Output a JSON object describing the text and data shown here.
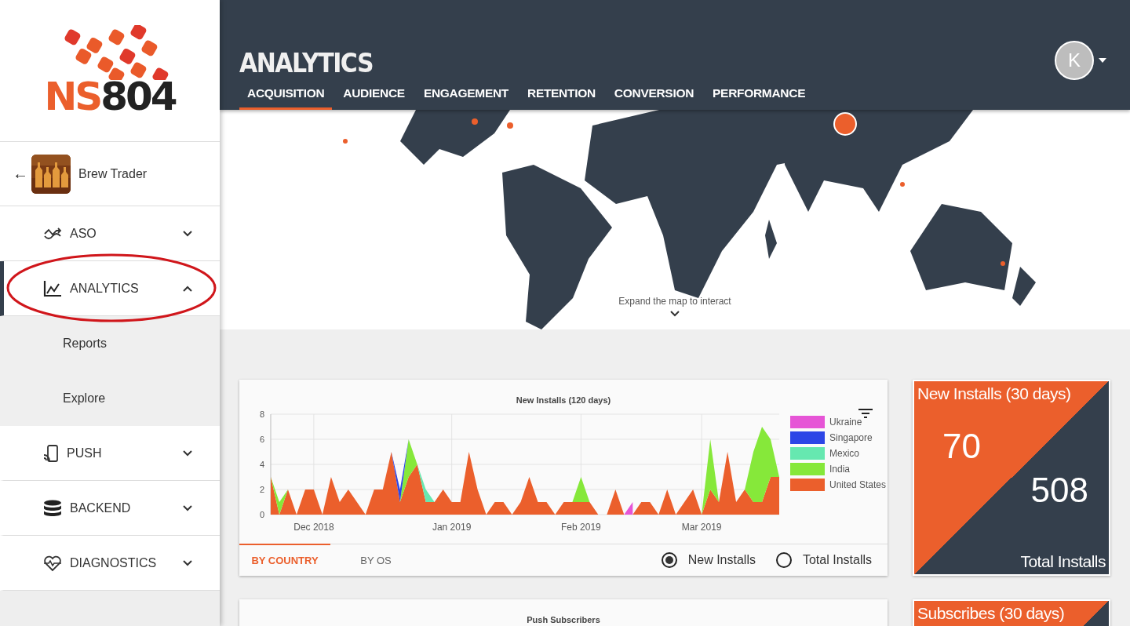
{
  "logo": {
    "accent": "NS",
    "rest": "804"
  },
  "app": {
    "back": "←",
    "name": "Brew Trader"
  },
  "nav": [
    {
      "label": "ASO",
      "expanded": false,
      "selected": false
    },
    {
      "label": "ANALYTICS",
      "expanded": true,
      "selected": true,
      "children": [
        {
          "label": "Reports"
        },
        {
          "label": "Explore"
        }
      ]
    },
    {
      "label": "PUSH",
      "expanded": false,
      "selected": false
    },
    {
      "label": "BACKEND",
      "expanded": false,
      "selected": false
    },
    {
      "label": "DIAGNOSTICS",
      "expanded": false,
      "selected": false
    }
  ],
  "header": {
    "title": "ANALYTICS",
    "avatar": "K",
    "tabs": [
      {
        "label": "ACQUISITION",
        "selected": true
      },
      {
        "label": "AUDIENCE",
        "selected": false
      },
      {
        "label": "ENGAGEMENT",
        "selected": false
      },
      {
        "label": "RETENTION",
        "selected": false
      },
      {
        "label": "CONVERSION",
        "selected": false
      },
      {
        "label": "PERFORMANCE",
        "selected": false
      }
    ]
  },
  "map": {
    "kind": "picture",
    "hint": "Expand the map to interact"
  },
  "installs_chart": {
    "chart_data": {
      "type": "area",
      "title": "New Installs (120 days)",
      "stacked": true,
      "categories": [
        null,
        null,
        null,
        null,
        null,
        "Dec 2018",
        null,
        null,
        null,
        null,
        null,
        null,
        null,
        null,
        null,
        null,
        null,
        null,
        null,
        null,
        null,
        "Jan 2019",
        null,
        null,
        null,
        null,
        null,
        null,
        null,
        null,
        null,
        null,
        null,
        null,
        null,
        null,
        "Feb 2019",
        null,
        null,
        null,
        null,
        null,
        null,
        null,
        null,
        null,
        null,
        null,
        null,
        null,
        "Mar 2019",
        null,
        null,
        null,
        null,
        null,
        null,
        null,
        null,
        null
      ],
      "ylim": [
        0,
        8
      ],
      "grid": true,
      "yticks": [
        0,
        2,
        4,
        6,
        8
      ],
      "series": [
        {
          "name": "United States",
          "color": "#eb5f2c",
          "values": [
            3,
            0,
            2,
            0,
            2,
            2,
            0,
            3,
            1,
            2,
            1,
            0,
            2,
            2,
            5,
            1,
            3,
            4,
            1,
            1,
            2,
            1,
            1,
            5,
            2,
            0,
            1,
            1,
            0,
            1,
            3,
            1,
            1,
            0,
            1,
            1,
            1,
            1,
            0,
            0,
            2,
            0,
            0,
            1,
            1,
            0,
            2,
            0,
            1,
            2,
            0,
            2,
            1,
            5,
            1,
            2,
            1,
            1,
            3,
            3
          ]
        },
        {
          "name": "India",
          "color": "#86e83a",
          "values": [
            0,
            1,
            0,
            0,
            0,
            0,
            0,
            0,
            0,
            0,
            0,
            0,
            0,
            0,
            0,
            0,
            3,
            0,
            0,
            0,
            0,
            0,
            0,
            0,
            0,
            0,
            0,
            0,
            0,
            0,
            0,
            0,
            0,
            0,
            0,
            0,
            2,
            0,
            0,
            0,
            0,
            0,
            0,
            0,
            0,
            0,
            0,
            0,
            0,
            0,
            0,
            4,
            0,
            0,
            0,
            0,
            4,
            6,
            3,
            0
          ]
        },
        {
          "name": "Mexico",
          "color": "#66e8b0",
          "values": [
            null,
            null,
            null,
            null,
            null,
            null,
            null,
            null,
            null,
            null,
            null,
            null,
            null,
            null,
            null,
            null,
            null,
            0,
            1,
            0,
            null,
            null,
            null,
            null,
            null,
            null,
            null,
            null,
            null,
            null,
            null,
            null,
            null,
            null,
            null,
            null,
            null,
            null,
            null,
            null,
            null,
            null,
            null,
            null,
            null,
            null,
            null,
            null,
            null,
            null,
            null,
            null,
            null,
            null,
            null,
            null,
            null,
            null,
            null,
            null
          ]
        },
        {
          "name": "Singapore",
          "color": "#2d46e6",
          "values": [
            null,
            null,
            null,
            null,
            null,
            null,
            null,
            null,
            null,
            null,
            null,
            null,
            null,
            null,
            0,
            1,
            0,
            null,
            null,
            null,
            null,
            null,
            null,
            null,
            null,
            null,
            null,
            null,
            null,
            null,
            null,
            null,
            null,
            null,
            null,
            null,
            null,
            null,
            null,
            null,
            null,
            null,
            null,
            null,
            null,
            null,
            null,
            null,
            null,
            null,
            null,
            null,
            null,
            null,
            null,
            null,
            null,
            null,
            null,
            null
          ]
        },
        {
          "name": "Ukraine",
          "color": "#e655d6",
          "values": [
            null,
            null,
            null,
            null,
            null,
            null,
            null,
            null,
            null,
            null,
            null,
            null,
            null,
            null,
            null,
            null,
            null,
            null,
            null,
            null,
            null,
            null,
            null,
            null,
            null,
            null,
            null,
            null,
            null,
            null,
            null,
            null,
            null,
            null,
            null,
            null,
            null,
            null,
            null,
            null,
            null,
            0,
            1,
            null,
            null,
            null,
            null,
            null,
            null,
            null,
            null,
            null,
            null,
            null,
            null,
            null,
            null,
            null,
            null,
            null
          ]
        }
      ]
    },
    "tabs": [
      {
        "label": "BY COUNTRY",
        "selected": true
      },
      {
        "label": "BY OS",
        "selected": false
      }
    ],
    "radios": [
      {
        "label": "New Installs",
        "selected": true
      },
      {
        "label": "Total Installs",
        "selected": false
      }
    ]
  },
  "stat_card": {
    "title": "New Installs (30 days)",
    "new_value": "70",
    "total_value": "508",
    "total_label": "Total Installs"
  },
  "push_chart": {
    "title": "Push Subscribers"
  },
  "subscribes_card": {
    "title": "Subscribes (30 days)"
  }
}
